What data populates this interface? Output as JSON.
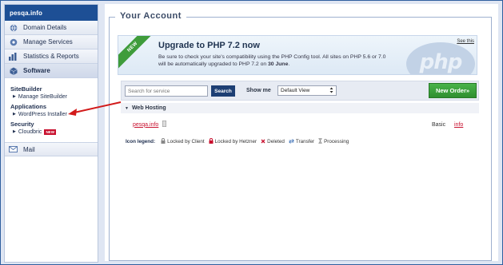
{
  "sidebar": {
    "header": "pesqa.info",
    "nav": [
      {
        "label": "Domain Details",
        "icon": "globe-icon"
      },
      {
        "label": "Manage Services",
        "icon": "gear-icon"
      },
      {
        "label": "Statistics & Reports",
        "icon": "bar-chart-icon"
      },
      {
        "label": "Software",
        "icon": "cube-icon"
      }
    ],
    "software_sections": {
      "sitebuilder_title": "SiteBuilder",
      "sitebuilder_link": "Manage SiteBuilder",
      "applications_title": "Applications",
      "applications_link": "WordPress Installer",
      "security_title": "Security",
      "security_link": "Cloudbric",
      "security_badge": "NEW"
    },
    "mail": {
      "label": "Mail",
      "icon": "envelope-icon"
    }
  },
  "main": {
    "title": "Your Account",
    "banner": {
      "ribbon": "NEW",
      "title": "Upgrade to PHP 7.2 now",
      "text_line1": "Be sure to check your site's compatibility using the PHP Config tool. All sites on PHP 5.6 or 7.0",
      "text_line2_prefix": "will be automatically upgraded to PHP 7.2 on ",
      "text_line2_date": "30 June",
      "text_line2_suffix": ".",
      "see_this": "See this",
      "logo_text": "php"
    },
    "toolbar": {
      "search_placeholder": "Search for service",
      "search_button": "Search",
      "show_me_label": "Show me",
      "view_selected": "Default View",
      "new_order_button": "New Order»"
    },
    "section": {
      "title": "Web Hosting",
      "rows": [
        {
          "domain": "pesqa.info",
          "plan": "Basic",
          "info": "info"
        }
      ]
    },
    "legend": {
      "label": "Icon legend:",
      "items": [
        {
          "label": "Locked by Client",
          "icon": "lock-icon"
        },
        {
          "label": "Locked by Hetzner",
          "icon": "red-lock-icon"
        },
        {
          "label": "Deleted",
          "icon": "x-icon"
        },
        {
          "label": "Transfer",
          "icon": "transfer-icon"
        },
        {
          "label": "Processing",
          "icon": "hourglass-icon"
        }
      ]
    }
  },
  "colors": {
    "brand_blue": "#1d4f95",
    "accent_red": "#c8102e",
    "order_green": "#3f9c3b"
  }
}
